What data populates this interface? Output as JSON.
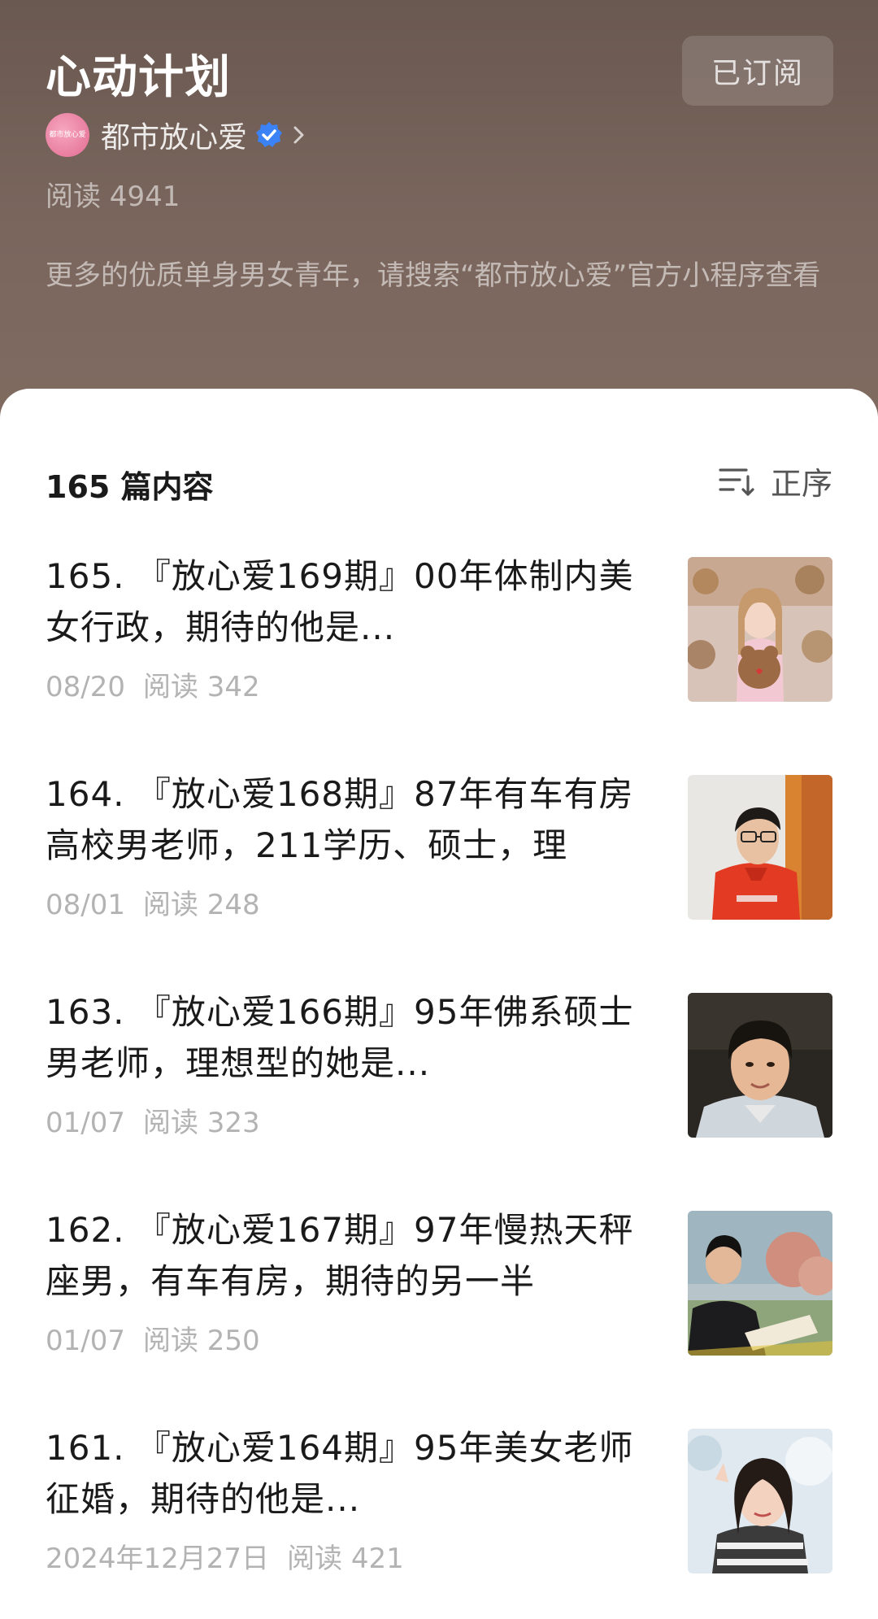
{
  "header": {
    "title": "心动计划",
    "subscribe_label": "已订阅",
    "account_name": "都市放心爱",
    "avatar_text": "都市放心爱",
    "reads": "阅读 4941",
    "description": "更多的优质单身男女青年，请搜索“都市放心爱”官方小程序查看"
  },
  "list": {
    "count_label": "165 篇内容",
    "sort_label": "正序",
    "articles": [
      {
        "title": "165. 『放心爱169期』00年体制内美女行政，期待的他是...",
        "date": "08/20",
        "reads": "阅读 342",
        "thumbnail": "woman-with-teddy-bear-photo"
      },
      {
        "title": "164. 『放心爱168期』87年有车有房高校男老师，211学历、硕士，理",
        "date": "08/01",
        "reads": "阅读 248",
        "thumbnail": "man-in-red-hoodie-photo"
      },
      {
        "title": "163. 『放心爱166期』95年佛系硕士男老师，理想型的她是...",
        "date": "01/07",
        "reads": "阅读 323",
        "thumbnail": "man-portrait-photo"
      },
      {
        "title": "162. 『放心爱167期』97年慢热天秤座男，有车有房，期待的另一半",
        "date": "01/07",
        "reads": "阅读 250",
        "thumbnail": "man-reading-book-photo"
      },
      {
        "title": "161. 『放心爱164期』95年美女老师征婚，期待的他是...",
        "date": "2024年12月27日",
        "reads": "阅读 421",
        "thumbnail": "woman-peace-sign-photo"
      }
    ]
  },
  "colors": {
    "header_bg": "#6a5951",
    "verified": "#3b82f6",
    "avatar": "#e36b92"
  }
}
